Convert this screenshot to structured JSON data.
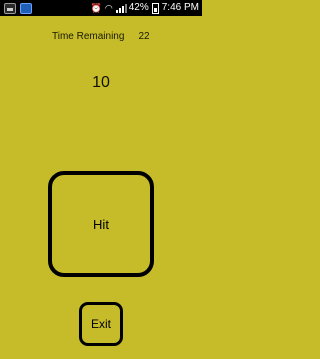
{
  "status_bar": {
    "battery_percent": "42%",
    "time": "7:46 PM",
    "left_icons": [
      "gallery-notification-icon",
      "app-notification-icon"
    ],
    "right_icons": [
      "alarm-icon",
      "wifi-icon",
      "signal-icon",
      "battery-icon"
    ]
  },
  "game": {
    "time_remaining_label": "Time Remaining",
    "time_remaining_value": "22",
    "score": "10",
    "hit_label": "Hit",
    "exit_label": "Exit"
  },
  "colors": {
    "background": "#c6bc2a",
    "status_bar": "#000000",
    "button_border": "#000000"
  }
}
